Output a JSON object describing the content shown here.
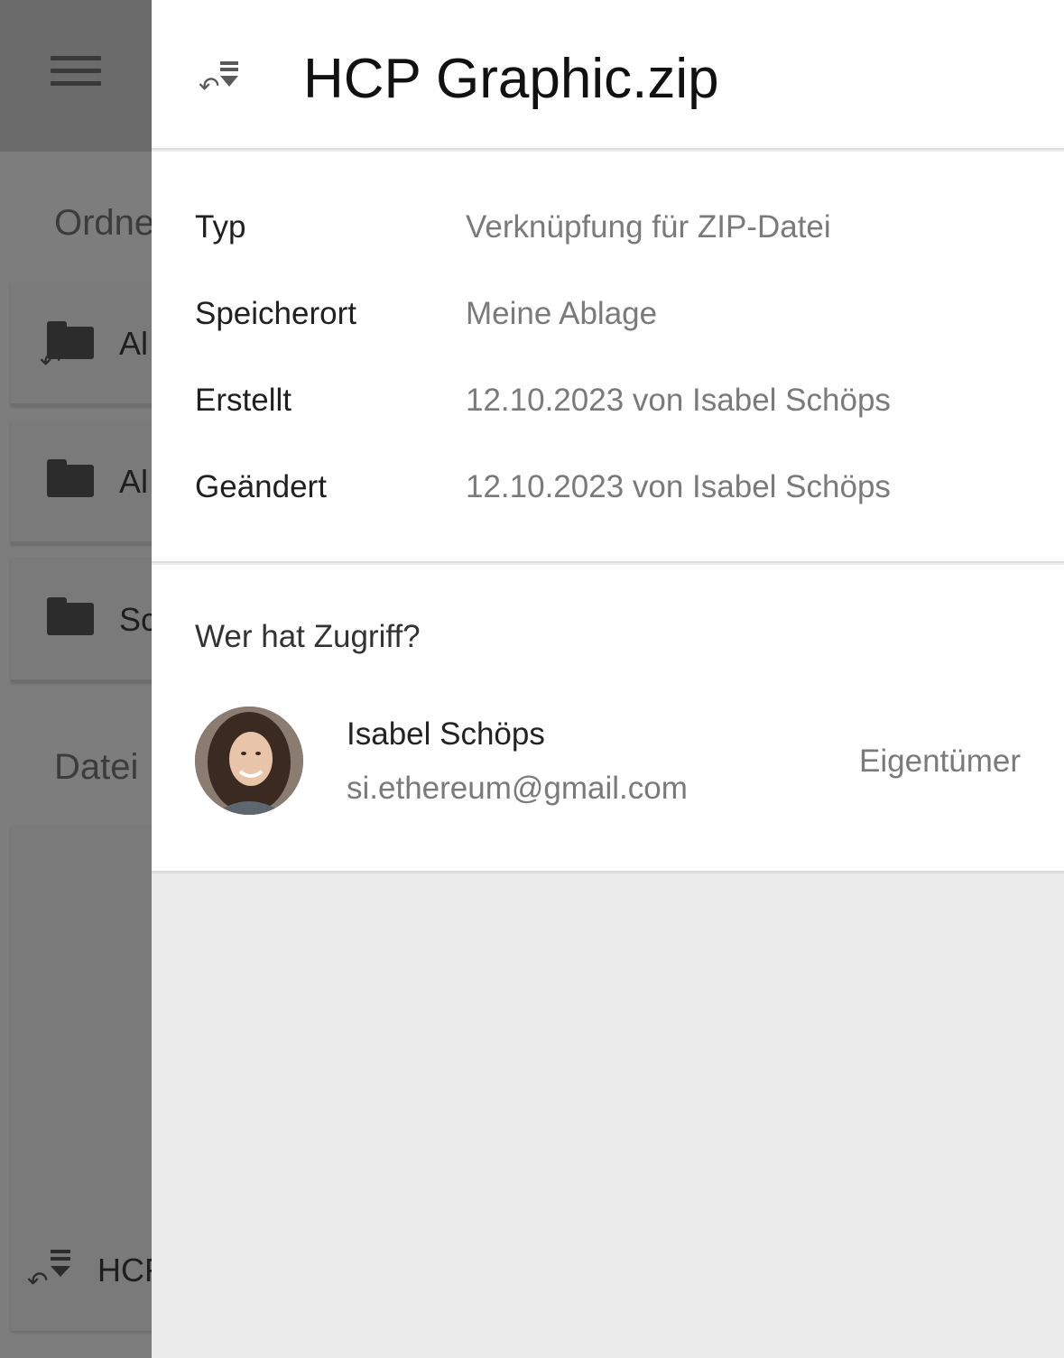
{
  "background": {
    "sections": {
      "folders_label": "Ordne",
      "files_label": "Datei"
    },
    "folders": [
      {
        "label": "Al",
        "icon": "folder-shortcut-icon"
      },
      {
        "label": "Al",
        "icon": "folder-icon"
      },
      {
        "label": "Sc",
        "icon": "folder-icon"
      }
    ],
    "file_item": {
      "label": "HCF",
      "icon": "zip-shortcut-icon"
    }
  },
  "panel": {
    "title": "HCP Graphic.zip",
    "icon": "zip-shortcut-icon",
    "details": [
      {
        "key": "Typ",
        "value": "Verknüpfung für ZIP-Datei"
      },
      {
        "key": "Speicherort",
        "value": "Meine Ablage"
      },
      {
        "key": "Erstellt",
        "value": "12.10.2023 von Isabel Schöps"
      },
      {
        "key": "Geändert",
        "value": "12.10.2023 von Isabel Schöps"
      }
    ],
    "access": {
      "title": "Wer hat Zugriff?",
      "user": {
        "name": "Isabel Schöps",
        "email": "si.ethereum@gmail.com",
        "role": "Eigentümer"
      }
    }
  }
}
